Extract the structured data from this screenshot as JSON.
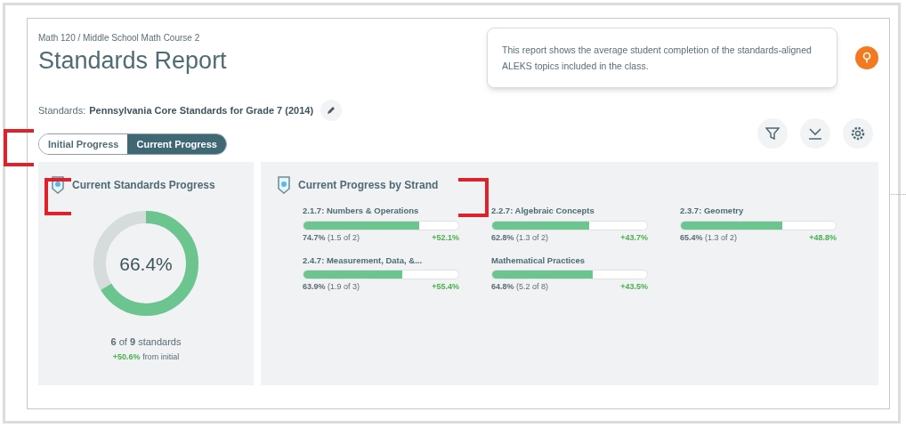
{
  "breadcrumb": "Math 120 / Middle School Math Course 2",
  "title": "Standards Report",
  "standards": {
    "label": "Standards:",
    "value": "Pennsylvania Core Standards for Grade 7 (2014)"
  },
  "info_tooltip": "This report shows the average student completion of the standards-aligned ALEKS topics included in the class.",
  "progress_tabs": [
    {
      "label": "Initial Progress",
      "selected": false
    },
    {
      "label": "Current Progress",
      "selected": true
    }
  ],
  "summary_panel": {
    "title": "Current Standards Progress",
    "donut_label": "66.4%",
    "level": 0.664,
    "count_parts": [
      "6",
      " of ",
      "9",
      " standards"
    ],
    "change": "+50.6%",
    "change_suffix": " from initial"
  },
  "strand_panel": {
    "title": "Current Progress by Strand",
    "strands": [
      {
        "name": "2.1.7: Numbers & Operations",
        "level": 0.747,
        "percent": "74.7%",
        "detail": "(1.5 of 2)",
        "change": "+52.1%"
      },
      {
        "name": "2.2.7: Algebraic Concepts",
        "level": 0.628,
        "percent": "62.8%",
        "detail": "(1.3 of 2)",
        "change": "+43.7%"
      },
      {
        "name": "2.3.7: Geometry",
        "level": 0.654,
        "percent": "65.4%",
        "detail": "(1.3 of 2)",
        "change": "+48.8%"
      },
      {
        "name": "2.4.7: Measurement, Data, &...",
        "level": 0.639,
        "percent": "63.9%",
        "detail": "(1.9 of 3)",
        "change": "+55.4%"
      },
      {
        "name": "Mathematical Practices",
        "level": 0.648,
        "percent": "64.8%",
        "detail": "(5.2 of 8)",
        "change": "+43.5%"
      }
    ]
  }
}
